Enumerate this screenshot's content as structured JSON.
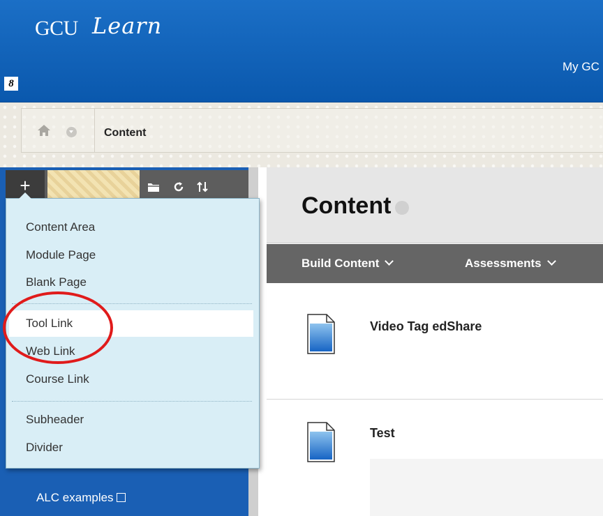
{
  "header": {
    "logo_primary": "GCU",
    "logo_secondary": "Learn",
    "link_text": "My GC",
    "quick_link_glyph": "8"
  },
  "breadcrumb": {
    "current": "Content"
  },
  "sidebar": {
    "plus_label": "+",
    "toolbar_icons": [
      "folder-icon",
      "refresh-icon",
      "sort-icon"
    ],
    "items": [
      {
        "label": "ALC examples",
        "icon": "hidden-icon"
      }
    ]
  },
  "add_menu": {
    "items": [
      {
        "label": "Content Area"
      },
      {
        "label": "Module Page"
      },
      {
        "label": "Blank Page"
      },
      {
        "label": "Tool Link",
        "highlighted": true
      },
      {
        "label": "Web Link"
      },
      {
        "label": "Course Link"
      },
      {
        "label": "Subheader"
      },
      {
        "label": "Divider"
      }
    ],
    "annotation_color": "#e01b1b"
  },
  "main": {
    "title": "Content",
    "actions": [
      {
        "label": "Build Content"
      },
      {
        "label": "Assessments"
      }
    ],
    "content_items": [
      {
        "title": "Video Tag edShare",
        "icon": "document-icon"
      },
      {
        "title": "Test",
        "icon": "document-icon"
      }
    ]
  },
  "colors": {
    "header_blue": "#0a58ad",
    "menu_bg": "#d9eef6",
    "action_bar": "#656565"
  }
}
